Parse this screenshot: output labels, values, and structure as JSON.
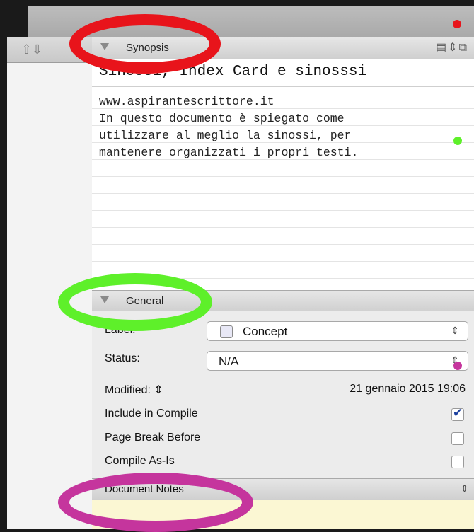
{
  "nav": {
    "arrows": "⇧⇩"
  },
  "synopsis": {
    "header_label": "Synopsis",
    "tools": "▤⇕⧉",
    "title": "Sinossi, Index Card e sinosssi",
    "body": "www.aspirantescrittore.it\nIn questo documento è spiegato come\nutilizzare al meglio la sinossi, per\nmantenere organizzati i propri testi."
  },
  "general": {
    "header_label": "General",
    "label_caption": "Label:",
    "label_value": "Concept",
    "status_caption": "Status:",
    "status_value": "N/A",
    "modified_caption": "Modified: ⇕",
    "modified_value": "21 gennaio 2015 19:06",
    "include_caption": "Include in Compile",
    "pagebreak_caption": "Page Break Before",
    "compile_as_is_caption": "Compile As-Is",
    "popup_arrow": "⇕"
  },
  "notes": {
    "header_label": "Document Notes",
    "arrow": "⇕"
  },
  "colors": {
    "annotation_red": "#e8141b",
    "annotation_green": "#5ef02a",
    "annotation_magenta": "#c5359d",
    "checkbox_blue": "#1b3f9e",
    "notes_yellow": "#fbf7d3"
  },
  "icons": [
    "home-up-arrow-icon",
    "down-arrow-icon",
    "list-icon",
    "stepper-icon",
    "window-icon",
    "checkmark-icon"
  ]
}
